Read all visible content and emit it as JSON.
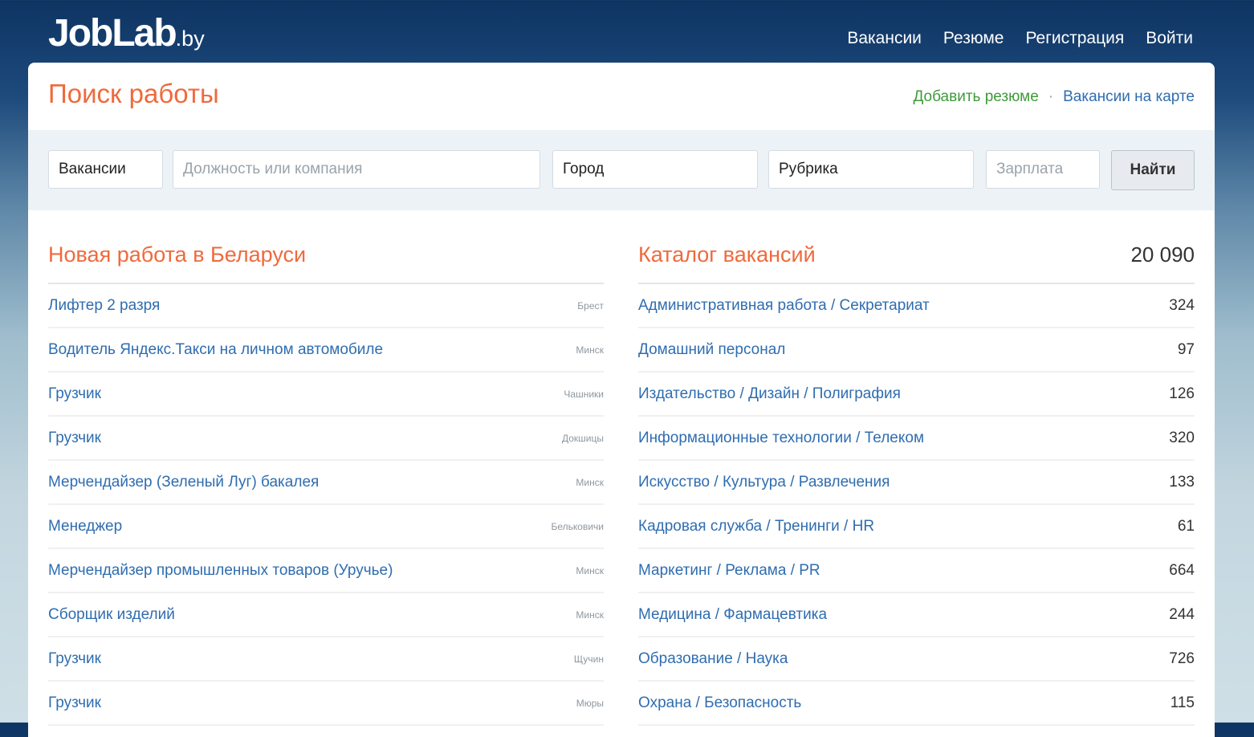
{
  "header": {
    "logo_main": "JobLab",
    "logo_tld": ".by",
    "nav": [
      "Вакансии",
      "Резюме",
      "Регистрация",
      "Войти"
    ]
  },
  "page": {
    "title": "Поиск работы",
    "add_resume": "Добавить резюме",
    "separator": "·",
    "map_link": "Вакансии на карте"
  },
  "search": {
    "type_value": "Вакансии",
    "query_placeholder": "Должность или компания",
    "city_value": "Город",
    "category_value": "Рубрика",
    "salary_placeholder": "Зарплата",
    "submit_label": "Найти"
  },
  "jobs": {
    "title": "Новая работа в Беларуси",
    "items": [
      {
        "title": "Лифтер 2 разря",
        "city": "Брест"
      },
      {
        "title": "Водитель Яндекс.Такси на личном автомобиле",
        "city": "Минск"
      },
      {
        "title": "Грузчик",
        "city": "Чашники"
      },
      {
        "title": "Грузчик",
        "city": "Докшицы"
      },
      {
        "title": "Мерчендайзер (Зеленый Луг) бакалея",
        "city": "Минск"
      },
      {
        "title": "Менеджер",
        "city": "Бельковичи"
      },
      {
        "title": "Мерчендайзер промышленных товаров (Уручье)",
        "city": "Минск"
      },
      {
        "title": "Сборщик изделий",
        "city": "Минск"
      },
      {
        "title": "Грузчик",
        "city": "Щучин"
      },
      {
        "title": "Грузчик",
        "city": "Мюры"
      }
    ]
  },
  "catalog": {
    "title": "Каталог вакансий",
    "total": "20 090",
    "items": [
      {
        "name": "Административная работа / Секретариат",
        "count": "324"
      },
      {
        "name": "Домашний персонал",
        "count": "97"
      },
      {
        "name": "Издательство / Дизайн / Полиграфия",
        "count": "126"
      },
      {
        "name": "Информационные технологии / Телеком",
        "count": "320"
      },
      {
        "name": "Искусство / Культура / Развлечения",
        "count": "133"
      },
      {
        "name": "Кадровая служба / Тренинги / HR",
        "count": "61"
      },
      {
        "name": "Маркетинг / Реклама / PR",
        "count": "664"
      },
      {
        "name": "Медицина / Фармацевтика",
        "count": "244"
      },
      {
        "name": "Образование / Наука",
        "count": "726"
      },
      {
        "name": "Охрана / Безопасность",
        "count": "115"
      }
    ]
  }
}
